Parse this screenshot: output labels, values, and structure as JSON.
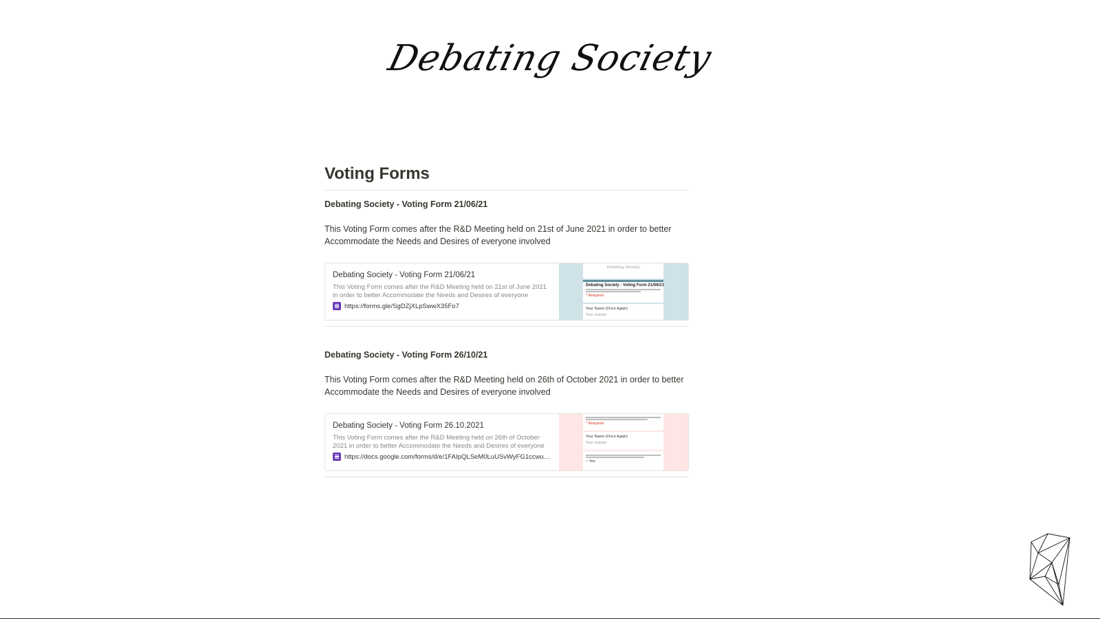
{
  "site": {
    "logo_text": "Debating Society"
  },
  "page": {
    "title": "Voting Forms"
  },
  "entries": [
    {
      "heading": "Debating Society - Voting Form 21/06/21",
      "description": "This Voting Form comes after the R&D Meeting held on 21st of June 2021 in order to better Accommodate the Needs and Desires of everyone involved",
      "bookmark": {
        "title": "Debating Society - Voting Form 21/06/21",
        "description": "This Voting Form comes after the R&D Meeting held on 21st of June 2021 in order to better Accommodate the Needs and Desires of everyone involved",
        "url": "https://forms.gle/SgDZjXLpSwwX35Fo7",
        "icon": "google-forms-icon",
        "thumbnail_color": "#cfe2e8",
        "thumbnail_lines": [
          "Debating Society - Voting Form 21/06/21",
          "* Required",
          "Your Name (Once Again)",
          "Your answer"
        ]
      }
    },
    {
      "heading": "Debating Society - Voting Form 26/10/21",
      "description": "This Voting Form comes after the R&D Meeting held on 26th of October 2021 in order to better Accommodate the Needs and Desires of everyone involved",
      "bookmark": {
        "title": "Debating Society - Voting Form 26.10.2021",
        "description": "This Voting Form comes after the R&D Meeting held on 26th of October 2021 in order to better Accommodate the Needs and Desires of everyone involved",
        "url": "https://docs.google.com/forms/d/e/1FAIpQLSeM0LuUSvWyFG1ccwuR4S...",
        "icon": "google-forms-icon",
        "thumbnail_color": "#fde6e3",
        "thumbnail_lines": [
          "* Required",
          "Your Name (Once Again)",
          "Your answer",
          "Yes"
        ]
      }
    }
  ],
  "colors": {
    "text": "#37352f",
    "muted": "#8a8883",
    "forms_purple": "#673ab7",
    "divider": "#e3e2e0"
  }
}
